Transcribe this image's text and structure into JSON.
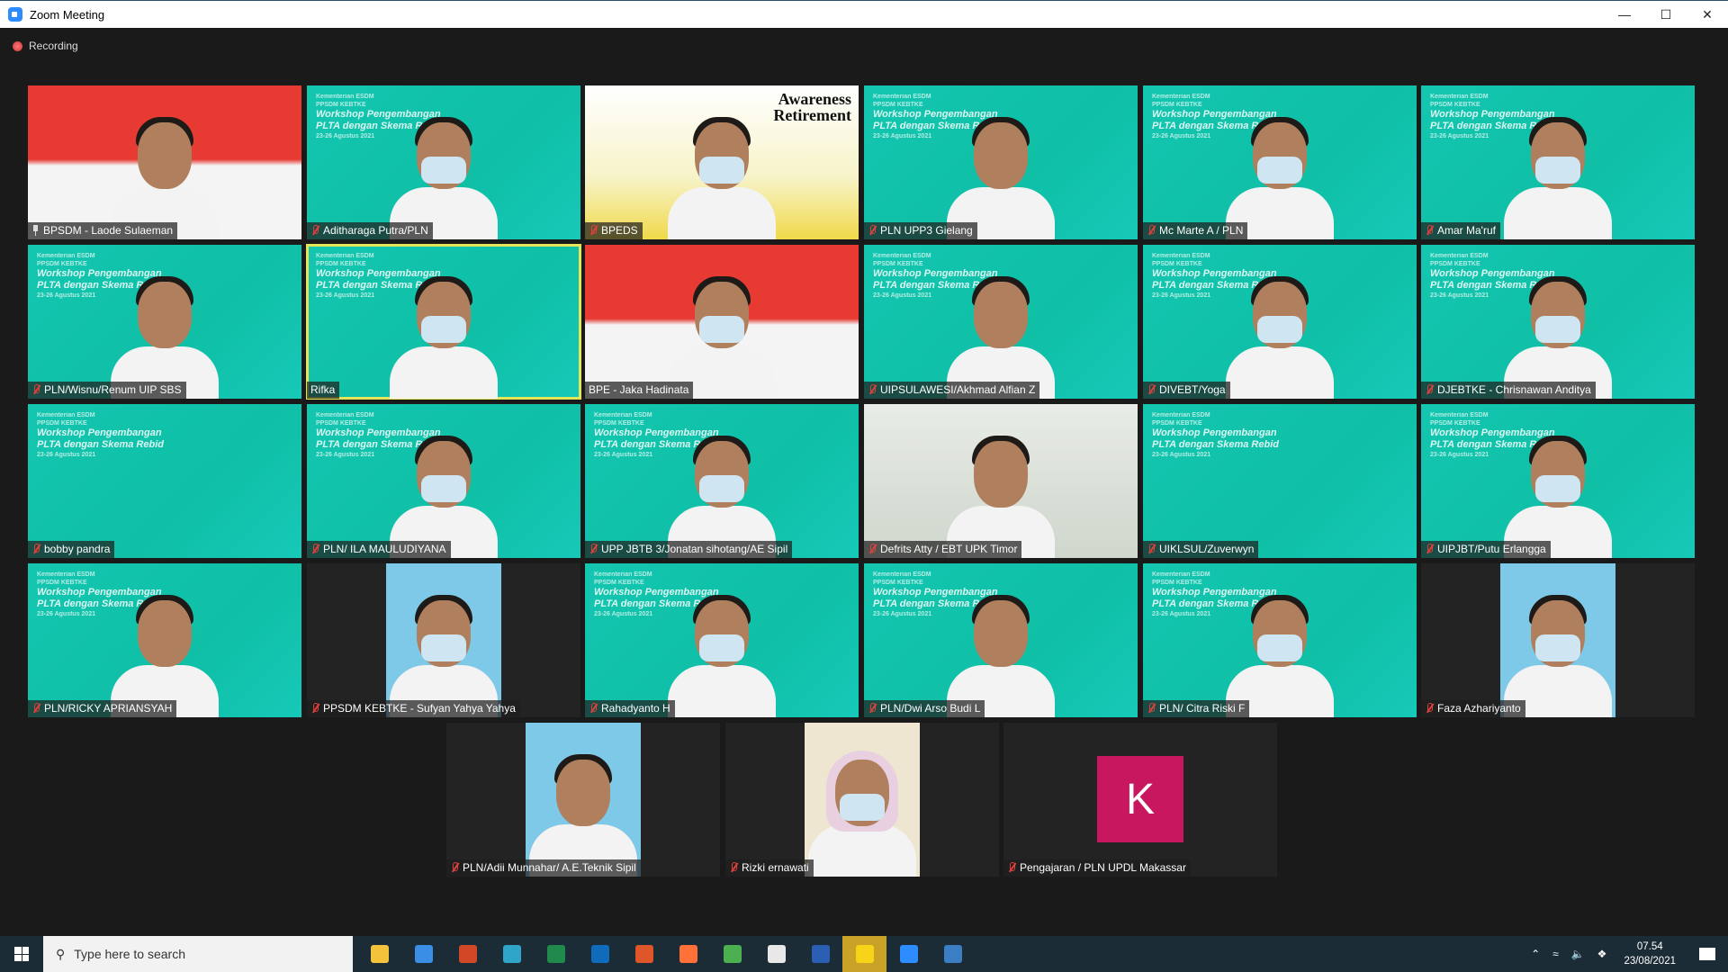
{
  "window": {
    "title": "Zoom Meeting",
    "recording_label": "Recording"
  },
  "participants": [
    {
      "name": "BPSDM - Laode Sulaeman",
      "bg": "flag",
      "icon": "pin-icon"
    },
    {
      "name": "Aditharaga Putra/PLN",
      "bg": "teal",
      "icon": "mic-muted-icon"
    },
    {
      "name": "BPEDS",
      "bg": "yellow",
      "icon": "mic-muted-icon",
      "banner": "Awareness Retirement"
    },
    {
      "name": "PLN UPP3 Gielang",
      "bg": "teal",
      "icon": "mic-muted-icon"
    },
    {
      "name": "Mc Marte A / PLN",
      "bg": "teal",
      "icon": "mic-muted-icon"
    },
    {
      "name": "Amar Ma'ruf",
      "bg": "teal",
      "icon": "mic-muted-icon"
    },
    {
      "name": "PLN/Wisnu/Renum UIP SBS",
      "bg": "teal",
      "icon": "mic-muted-icon"
    },
    {
      "name": "Rifka",
      "bg": "teal",
      "icon": "none",
      "active_speaker": true
    },
    {
      "name": "BPE - Jaka Hadinata",
      "bg": "flag",
      "icon": "none"
    },
    {
      "name": "UIPSULAWESI/Akhmad Alfian Z",
      "bg": "teal",
      "icon": "mic-muted-icon"
    },
    {
      "name": "DIVEBT/Yoga",
      "bg": "teal",
      "icon": "mic-muted-icon"
    },
    {
      "name": "DJEBTKE - Chrisnawan Anditya",
      "bg": "teal",
      "icon": "mic-muted-icon"
    },
    {
      "name": "bobby pandra",
      "bg": "teal",
      "icon": "mic-muted-icon",
      "empty": true
    },
    {
      "name": "PLN/ ILA MAULUDIYANA",
      "bg": "teal",
      "icon": "mic-muted-icon"
    },
    {
      "name": "UPP JBTB 3/Jonatan sihotang/AE Sipil",
      "bg": "teal",
      "icon": "mic-muted-icon"
    },
    {
      "name": "Defrits Atty / EBT UPK Timor",
      "bg": "grey",
      "icon": "mic-muted-icon"
    },
    {
      "name": "UIKLSUL/Zuverwyn",
      "bg": "teal",
      "icon": "mic-muted-icon",
      "empty": true
    },
    {
      "name": "UIPJBT/Putu Erlangga",
      "bg": "teal",
      "icon": "mic-muted-icon"
    },
    {
      "name": "PLN/RICKY APRIANSYAH",
      "bg": "teal",
      "icon": "mic-muted-icon"
    },
    {
      "name": "PPSDM KEBTKE - Sufyan Yahya Yahya",
      "bg": "none",
      "icon": "mic-muted-icon",
      "portrait": true
    },
    {
      "name": "Rahadyanto H",
      "bg": "teal",
      "icon": "mic-muted-icon"
    },
    {
      "name": "PLN/Dwi Arso Budi L",
      "bg": "teal",
      "icon": "mic-muted-icon"
    },
    {
      "name": "PLN/ Citra Riski F",
      "bg": "teal",
      "icon": "mic-muted-icon"
    },
    {
      "name": "Faza Azhariyanto",
      "bg": "none",
      "icon": "mic-muted-icon",
      "portrait": true
    },
    {
      "name": "PLN/Adii Munnahar/ A.E.Teknik Sipil",
      "bg": "none",
      "icon": "mic-muted-icon",
      "portrait": true
    },
    {
      "name": "Rizki ernawati",
      "bg": "none",
      "icon": "mic-muted-icon",
      "portrait": true,
      "hijab": true
    },
    {
      "name": "Pengajaran / PLN UPDL Makassar",
      "bg": "avatar",
      "icon": "mic-muted-icon",
      "avatar_letter": "K"
    }
  ],
  "backdrop_text": {
    "org": "Kementerian ESDM",
    "unit": "PPSDM KEBTKE",
    "line1": "Workshop Pengembangan",
    "line2": "PLTA dengan Skema Rebid",
    "date": "23-26 Agustus 2021"
  },
  "taskbar": {
    "search_placeholder": "Type here to search",
    "apps": [
      {
        "name": "file-explorer",
        "color": "#f3c33c"
      },
      {
        "name": "microsoft-store",
        "color": "#3a8ee6"
      },
      {
        "name": "powerpoint",
        "color": "#d24726"
      },
      {
        "name": "edge",
        "color": "#2fa5c9"
      },
      {
        "name": "excel",
        "color": "#1f8a4c"
      },
      {
        "name": "outlook",
        "color": "#0f6cbd"
      },
      {
        "name": "office-tools",
        "color": "#e0562b"
      },
      {
        "name": "firefox",
        "color": "#ff7139"
      },
      {
        "name": "chrome",
        "color": "#4caf50"
      },
      {
        "name": "notepad",
        "color": "#e8e8e8"
      },
      {
        "name": "word",
        "color": "#2b5fb3"
      },
      {
        "name": "sticky-notes",
        "color": "#f7d417",
        "active": true
      },
      {
        "name": "zoom",
        "color": "#2d8cff"
      },
      {
        "name": "photos",
        "color": "#3b7ec4"
      }
    ],
    "time": "07.54",
    "date": "23/08/2021"
  }
}
